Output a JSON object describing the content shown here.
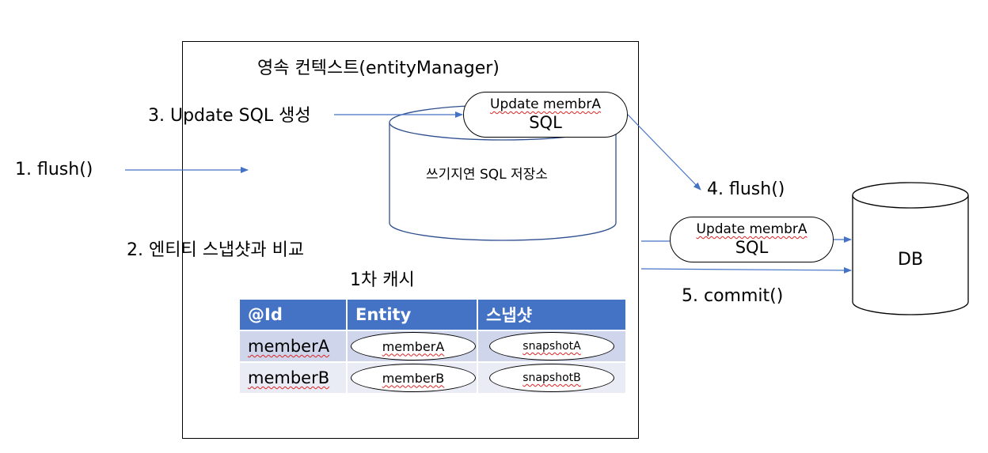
{
  "context_title": "영속  컨텍스트(entityManager)",
  "steps": {
    "flush1": "1. flush()",
    "compare": "2. 엔티티 스냅샷과 비교",
    "update_sql": "3. Update SQL 생성",
    "flush4": "4. flush()",
    "commit": "5. commit()"
  },
  "store_label": "쓰기지연 SQL 저장소",
  "sql_pill_top": {
    "line1": "Update membrA",
    "line2": "SQL"
  },
  "sql_pill_db": {
    "line1": "Update membrA",
    "line2": "SQL"
  },
  "db_label": "DB",
  "cache": {
    "title": "1차 캐시",
    "headers": [
      "@Id",
      "Entity",
      "스냅샷"
    ],
    "rows": [
      {
        "id": "memberA",
        "entity": "memberA",
        "snapshot": "snapshotA"
      },
      {
        "id": "memberB",
        "entity": "memberB",
        "snapshot": "snapshotB"
      }
    ]
  },
  "colors": {
    "arrow": "#4472c4",
    "table_header": "#4472c4",
    "row1": "#cfd5ea",
    "row2": "#e9ebf5"
  }
}
